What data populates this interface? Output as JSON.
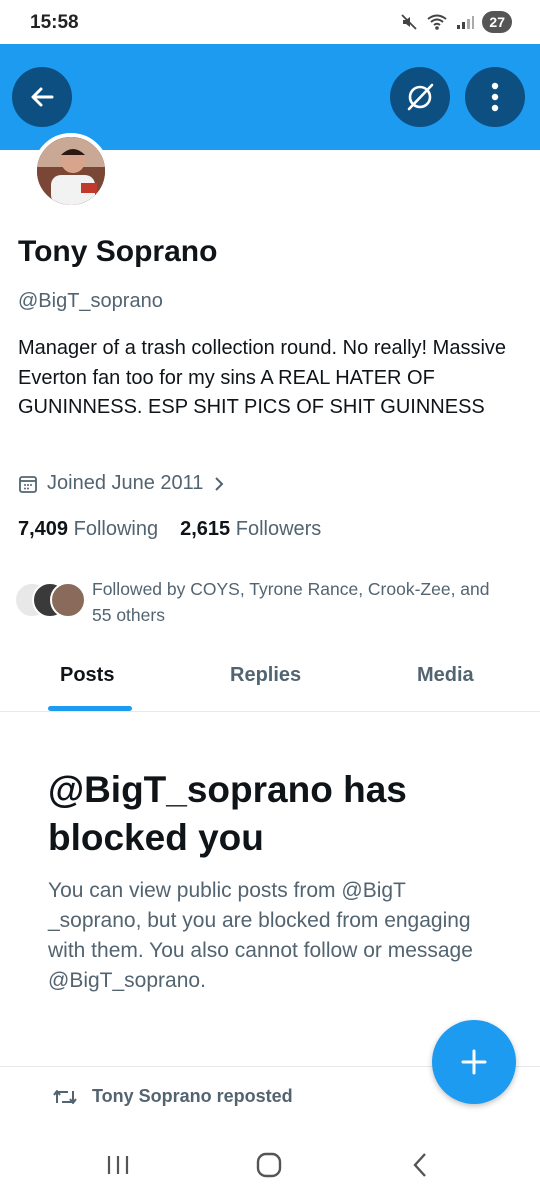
{
  "status_bar": {
    "time": "15:58",
    "battery": "27"
  },
  "profile": {
    "name": "Tony Soprano",
    "handle": "@BigT_soprano",
    "bio": "Manager of a trash collection round. No really! Massive Everton fan too for my sins A REAL HATER OF GUNINNESS. ESP SHIT PICS OF SHIT GUINNESS",
    "joined": "Joined June 2011",
    "following_count": "7,409",
    "following_label": "Following",
    "followers_count": "2,615",
    "followers_label": "Followers",
    "followed_by": "Followed by COYS, Tyrone Rance, Crook-Zee, and 55 others"
  },
  "tabs": [
    {
      "label": "Posts",
      "active": true
    },
    {
      "label": "Replies",
      "active": false
    },
    {
      "label": "Media",
      "active": false
    }
  ],
  "blocked": {
    "title": "@BigT_soprano has blocked you",
    "body": "You can view public posts from @BigT _soprano, but you are blocked from engaging with them. You also cannot follow or message @BigT_soprano."
  },
  "feed": {
    "reposted_label": "Tony Soprano reposted"
  },
  "icons": {
    "back": "arrow-left-icon",
    "grok": "grok-icon",
    "more": "more-vertical-icon",
    "calendar": "calendar-icon",
    "chevron": "chevron-right-icon",
    "repost": "repost-icon",
    "compose": "plus-icon"
  },
  "colors": {
    "accent": "#1d9bf0",
    "banner_button": "#0d4f80",
    "text_primary": "#0f1419",
    "text_secondary": "#536471"
  }
}
